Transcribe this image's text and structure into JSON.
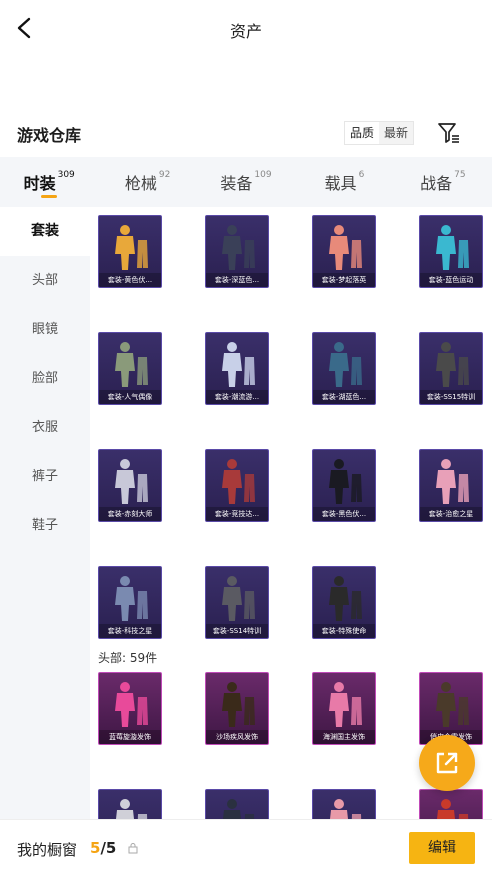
{
  "header": {
    "title": "资产"
  },
  "warehouse": {
    "title": "游戏仓库",
    "sort_options": [
      "品质",
      "最新"
    ],
    "filter_icon": "filter-icon"
  },
  "tabs": [
    {
      "label": "时装",
      "count": "309",
      "active": true
    },
    {
      "label": "枪械",
      "count": "92",
      "active": false
    },
    {
      "label": "装备",
      "count": "109",
      "active": false
    },
    {
      "label": "载具",
      "count": "6",
      "active": false
    },
    {
      "label": "战备",
      "count": "75",
      "active": false
    }
  ],
  "sidebar": {
    "items": [
      {
        "label": "套装",
        "active": true
      },
      {
        "label": "头部",
        "active": false
      },
      {
        "label": "眼镜",
        "active": false
      },
      {
        "label": "脸部",
        "active": false
      },
      {
        "label": "衣服",
        "active": false
      },
      {
        "label": "裤子",
        "active": false
      },
      {
        "label": "鞋子",
        "active": false
      }
    ]
  },
  "suits": {
    "items": [
      {
        "label": "套装-黄色伏...",
        "color": "#e8a83a",
        "rarity": "purple"
      },
      {
        "label": "套装-深蓝色...",
        "color": "#3a4058",
        "rarity": "purple"
      },
      {
        "label": "套装-梦起落英",
        "color": "#e88a7a",
        "rarity": "purple"
      },
      {
        "label": "套装-蓝色运动",
        "color": "#3ab8d0",
        "rarity": "purple"
      },
      {
        "label": "套装-人气偶像",
        "color": "#8a9a7a",
        "rarity": "purple"
      },
      {
        "label": "套装-潮流游...",
        "color": "#c8d0e8",
        "rarity": "purple"
      },
      {
        "label": "套装-湖蓝色...",
        "color": "#3a6a8a",
        "rarity": "purple"
      },
      {
        "label": "套装-SS15特训",
        "color": "#4a4a4a",
        "rarity": "purple"
      },
      {
        "label": "套装-赤刻大师",
        "color": "#c8c8d8",
        "rarity": "purple"
      },
      {
        "label": "套装-竞技达...",
        "color": "#a83a3a",
        "rarity": "purple"
      },
      {
        "label": "套装-黑色伏...",
        "color": "#1a1a22",
        "rarity": "purple"
      },
      {
        "label": "套装-治愈之星",
        "color": "#e8a0b8",
        "rarity": "purple"
      },
      {
        "label": "套装-科技之星",
        "color": "#7a8ab0",
        "rarity": "purple"
      },
      {
        "label": "套装-SS14特训",
        "color": "#5a5a62",
        "rarity": "purple"
      },
      {
        "label": "套装-特殊使命",
        "color": "#2a2a2a",
        "rarity": "purple"
      }
    ]
  },
  "head": {
    "count_label": "头部: 59件",
    "items": [
      {
        "label": "蓝莓旋漩发饰",
        "color": "#e84a9a",
        "rarity": "pink"
      },
      {
        "label": "沙场疾风发饰",
        "color": "#3a2a1a",
        "rarity": "pink"
      },
      {
        "label": "海渊国主发饰",
        "color": "#e87aa8",
        "rarity": "pink"
      },
      {
        "label": "俏皮金雷发饰",
        "color": "#4a3a2a",
        "rarity": "pink"
      },
      {
        "label": "",
        "color": "#d0d0d8",
        "rarity": "purple"
      },
      {
        "label": "",
        "color": "#2a3040",
        "rarity": "purple"
      },
      {
        "label": "",
        "color": "#e89aa8",
        "rarity": "purple"
      },
      {
        "label": "",
        "color": "#c83a2a",
        "rarity": "pink"
      }
    ]
  },
  "share_button": {
    "icon": "share-icon"
  },
  "showcase": {
    "label": "我的橱窗",
    "used": "5",
    "total": "/5",
    "lock_icon": "lock-icon",
    "edit_label": "编辑"
  }
}
